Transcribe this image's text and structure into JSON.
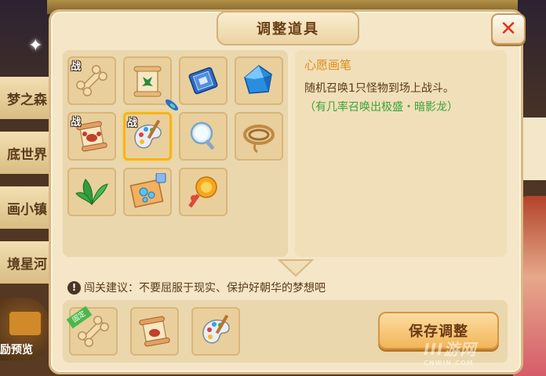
{
  "dialog": {
    "title": "调整道具",
    "close_icon": "close-x-icon"
  },
  "side_tabs": [
    "梦之森",
    "底世界",
    "画小镇",
    "境星河"
  ],
  "side_reward_label": "励预览",
  "items": [
    {
      "name": "bone-item",
      "tag": "战"
    },
    {
      "name": "scroll-green-item",
      "tag": ""
    },
    {
      "name": "blue-book-item",
      "tag": ""
    },
    {
      "name": "blue-crystal-item",
      "tag": ""
    },
    {
      "name": "scroll-crab-item",
      "tag": "战"
    },
    {
      "name": "palette-brush-item",
      "tag": "战"
    },
    {
      "name": "magic-mirror-item",
      "tag": ""
    },
    {
      "name": "rope-coil-item",
      "tag": ""
    },
    {
      "name": "green-leaves-item",
      "tag": ""
    },
    {
      "name": "magic-map-item",
      "tag": ""
    },
    {
      "name": "lollipop-item",
      "tag": ""
    }
  ],
  "selected_item": {
    "name": "心愿画笔",
    "desc": "随机召唤1只怪物到场上战斗。",
    "desc_green": "（有几率召唤出极盛・暗影龙）"
  },
  "tip": {
    "icon": "exclamation-icon",
    "text": "闯关建议：不要屈服于现实、保护好朝华的梦想吧"
  },
  "equipped": [
    {
      "name": "bone-item",
      "badge": "固定"
    },
    {
      "name": "scroll-crab-item",
      "badge": ""
    },
    {
      "name": "palette-brush-item",
      "badge": ""
    }
  ],
  "save_button_label": "保存调整",
  "watermark": {
    "main": "III游网",
    "sub": "CNWIN.COM"
  },
  "colors": {
    "accent_gold": "#f7b318",
    "close_red": "#e2341b",
    "green_text": "#3aa43a",
    "name_orange": "#d98e1a"
  }
}
